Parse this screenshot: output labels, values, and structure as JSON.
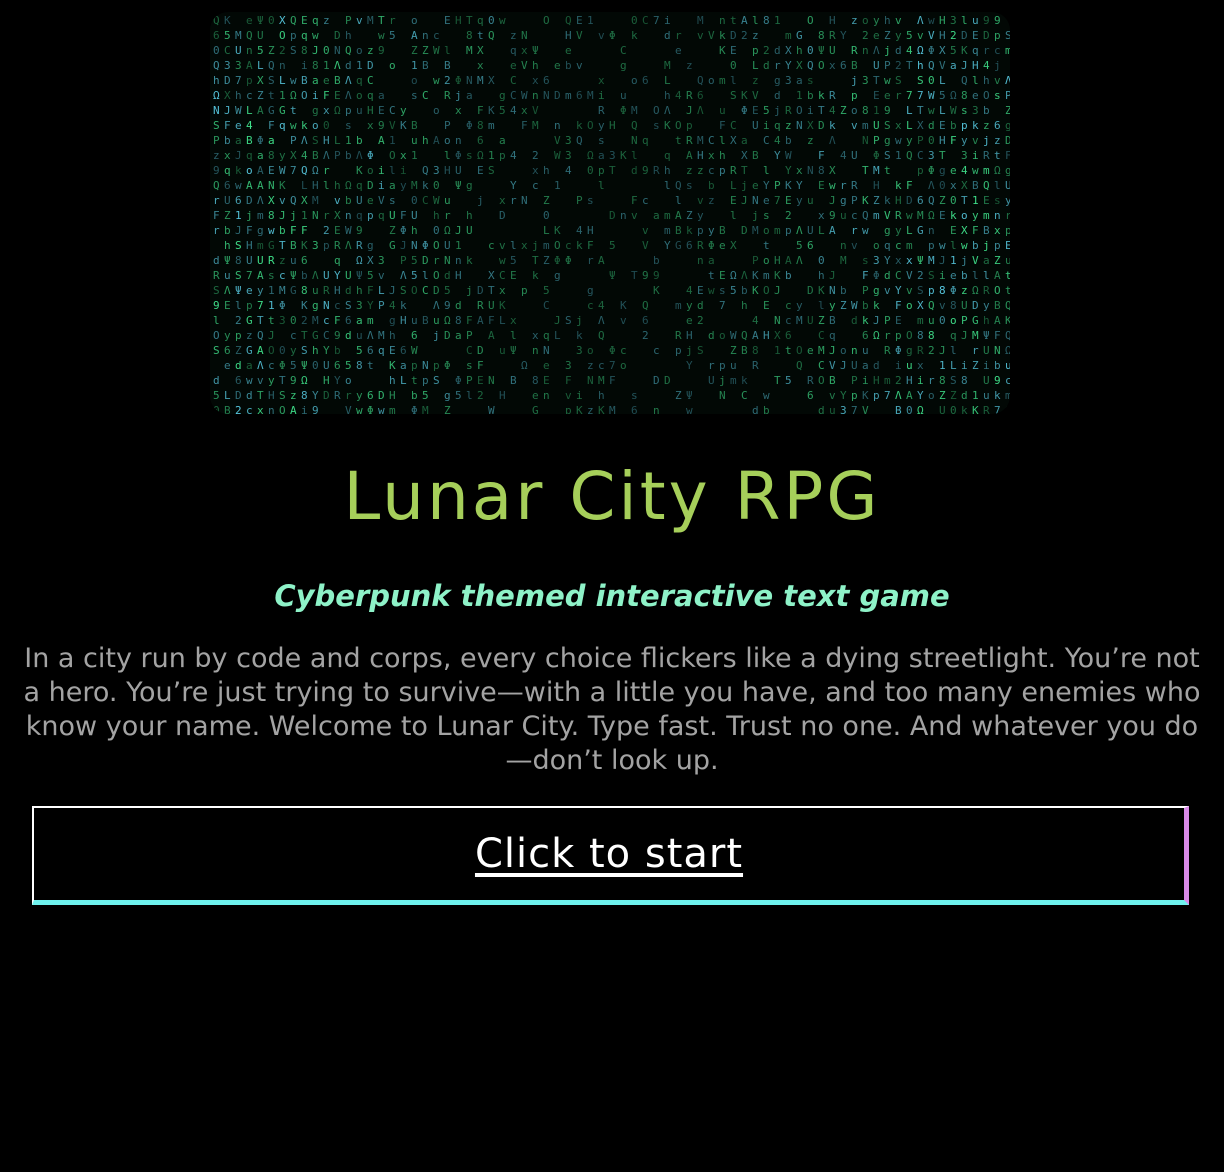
{
  "hero_image": {
    "icon": "matrix-code-rain-image",
    "colors": {
      "primary_glyph": "#3fe08a",
      "secondary_glyph": "#57c9e0",
      "background": "#020805"
    }
  },
  "header": {
    "title": "Lunar City RPG",
    "subtitle": "Cyberpunk themed interactive text game"
  },
  "intro": {
    "text": "In a city run by code and corps, every choice flickers like a dying streetlight. You’re not a hero. You’re just trying to survive—with a little you have, and too many enemies who know your name. Welcome to Lunar City. Type fast. Trust no one. And whatever you do—don’t look up."
  },
  "start_button": {
    "label": "Click to start"
  },
  "colors": {
    "background": "#000000",
    "title": "#a6cf5a",
    "subtitle": "#8ef2c8",
    "body_text": "#a3a3a3",
    "button_text": "#ffffff",
    "button_accent_right": "#d98ae8",
    "button_accent_bottom": "#6ff2ee"
  }
}
